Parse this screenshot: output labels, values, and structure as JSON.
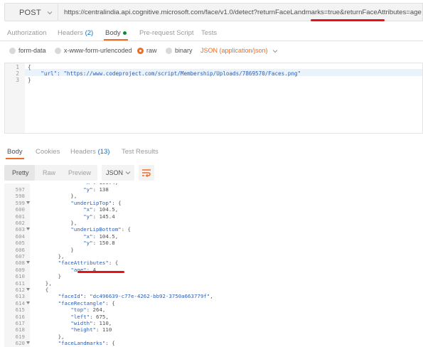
{
  "request": {
    "method": "POST",
    "url": "https://centralindia.api.cognitive.microsoft.com/face/v1.0/detect?returnFaceLandmarks=true&returnFaceAttributes=age"
  },
  "request_tabs": [
    {
      "label": "Authorization"
    },
    {
      "label": "Headers",
      "count": "(2)"
    },
    {
      "label": "Body"
    },
    {
      "label": "Pre-request Script"
    },
    {
      "label": "Tests"
    }
  ],
  "body_types": [
    "form-data",
    "x-www-form-urlencoded",
    "raw",
    "binary"
  ],
  "body_format": "JSON (application/json)",
  "request_body": {
    "line_numbers": [
      "1",
      "2",
      "3"
    ],
    "lines": [
      "{",
      "    \"url\": \"https://www.codeproject.com/script/Membership/Uploads/7869570/Faces.png\"",
      "}"
    ]
  },
  "response_tabs": [
    {
      "label": "Body"
    },
    {
      "label": "Cookies"
    },
    {
      "label": "Headers",
      "count": "(13)"
    },
    {
      "label": "Test Results"
    }
  ],
  "response_view": [
    "Pretty",
    "Raw",
    "Preview"
  ],
  "response_format": "JSON",
  "response": {
    "line_numbers": [
      "597",
      "598",
      "599",
      "600",
      "601",
      "602",
      "603",
      "604",
      "605",
      "606",
      "607",
      "608",
      "609",
      "610",
      "611",
      "612",
      "613",
      "614",
      "615",
      "616",
      "617",
      "618",
      "619",
      "620"
    ],
    "lines": [
      "                \"y\": 138",
      "            },",
      "            \"underLipTop\": {",
      "                \"x\": 104.5,",
      "                \"y\": 145.4",
      "            },",
      "            \"underLipBottom\": {",
      "                \"x\": 104.5,",
      "                \"y\": 150.8",
      "            }",
      "        },",
      "        \"faceAttributes\": {",
      "            \"age\": 4",
      "        }",
      "    },",
      "    {",
      "        \"faceId\": \"dc496639-c77e-4262-bb92-3750a663779f\",",
      "        \"faceRectangle\": {",
      "            \"top\": 264,",
      "            \"left\": 675,",
      "            \"width\": 110,",
      "            \"height\": 110",
      "        },",
      "        \"faceLandmarks\": {"
    ]
  },
  "colors": {
    "accent": "#ef6c24",
    "annotation": "#e8121a",
    "link": "#0a6fd1"
  }
}
